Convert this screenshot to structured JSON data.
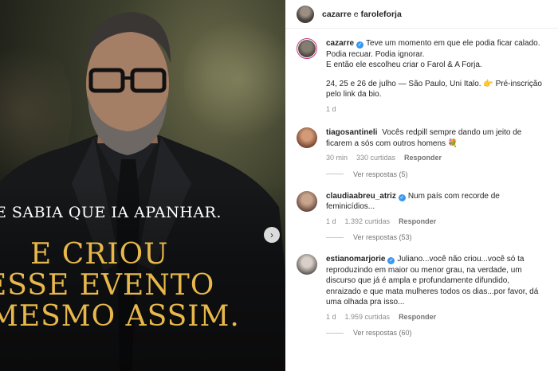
{
  "header": {
    "user1": "cazarre",
    "connector": "e",
    "user2": "faroleforja"
  },
  "media": {
    "line_small": "E SABIA QUE IA APANHAR.",
    "line1": "E CRIOU",
    "line2": "ESSE EVENTO",
    "line3": "MESMO ASSIM.",
    "next_icon": "chevron-right-icon"
  },
  "caption": {
    "username": "cazarre",
    "text1": "Teve um momento em que ele podia ficar calado. Podia recuar. Podia ignorar.",
    "text2": "E então ele escolheu criar o Farol & A Forja.",
    "text3": "24, 25 e 26 de julho — São Paulo, Uni Italo. 👉 Pré-inscrição pelo link da bio.",
    "time": "1 d"
  },
  "comments": [
    {
      "username": "tiagosantineli",
      "text": "Vocês redpill sempre dando um jeito de ficarem a sós com outros homens 💐",
      "time": "30 min",
      "likes": "330 curtidas",
      "reply": "Responder",
      "view_replies": "Ver respostas (5)"
    },
    {
      "username": "claudiaabreu_atriz",
      "text": "Num país com recorde de feminicídios...",
      "time": "1 d",
      "likes": "1.392 curtidas",
      "reply": "Responder",
      "view_replies": "Ver respostas (53)"
    },
    {
      "username": "estianomarjorie",
      "text": "Juliano...você não criou...você só ta reproduzindo em maior ou menor grau, na verdade, um discurso que já é ampla e profundamente difundido, enraizado e que mata mulheres todos os dias...por favor, dá uma olhada pra isso...",
      "time": "1 d",
      "likes": "1.959 curtidas",
      "reply": "Responder",
      "view_replies": "Ver respostas (60)"
    }
  ],
  "colors": {
    "verified": "#3897f0",
    "caption_gold": "#e8b84a"
  }
}
